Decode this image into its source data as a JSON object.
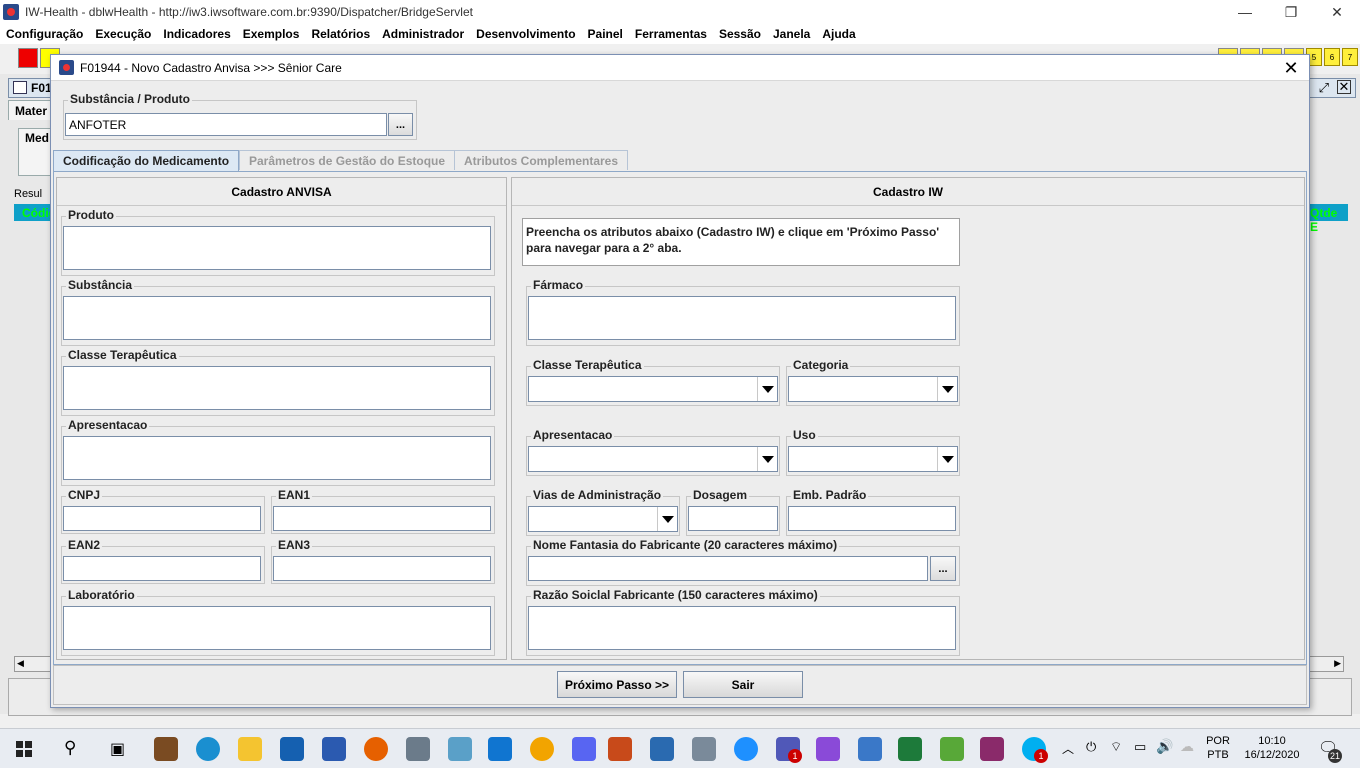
{
  "window": {
    "title": "IW-Health - dblwHealth - http://iw3.iwsoftware.com.br:9390/Dispatcher/BridgeServlet",
    "minimize": "—",
    "restore": "❐",
    "close": "✕"
  },
  "menu": [
    "Configuração",
    "Execução",
    "Indicadores",
    "Exemplos",
    "Relatórios",
    "Administrador",
    "Desenvolvimento",
    "Painel",
    "Ferramentas",
    "Sessão",
    "Janela",
    "Ajuda"
  ],
  "toolbar": {
    "number_boxes": [
      "5",
      "6",
      "7"
    ]
  },
  "background": {
    "frame_title": "F01",
    "tab_label": "Mater",
    "group_label": "Med",
    "result_label": "Resul",
    "col_left": "Códig",
    "col_right": "Qtde E"
  },
  "dialog": {
    "title": "F01944 - Novo Cadastro Anvisa >>> Sênior Care",
    "close": "✕",
    "substance": {
      "label": "Substância / Produto",
      "value": "ANFOTER",
      "lookup": "..."
    },
    "tabs": [
      "Codificação do Medicamento",
      "Parâmetros de Gestão do Estoque",
      "Atributos Complementares"
    ],
    "anvisa": {
      "header": "Cadastro ANVISA",
      "produto": "Produto",
      "substancia": "Substância",
      "classe": "Classe Terapêutica",
      "apresentacao": "Apresentacao",
      "cnpj": "CNPJ",
      "ean1": "EAN1",
      "ean2": "EAN2",
      "ean3": "EAN3",
      "laboratorio": "Laboratório"
    },
    "iw": {
      "header": "Cadastro IW",
      "info": "Preencha os atributos abaixo (Cadastro IW) e clique em 'Próximo Passo' para navegar para a 2° aba.",
      "farmaco": "Fármaco",
      "classe": "Classe Terapêutica",
      "categoria": "Categoria",
      "apresentacao": "Apresentacao",
      "uso": "Uso",
      "vias": "Vias de Administração",
      "dosagem": "Dosagem",
      "emb": "Emb. Padrão",
      "nome_fantasia": "Nome Fantasia do Fabricante (20 caracteres máximo)",
      "nome_lookup": "...",
      "razao": "Razão Soiclal Fabricante (150 caracteres máximo)"
    },
    "buttons": {
      "next": "Próximo Passo >>",
      "exit": "Sair"
    }
  },
  "taskbar": {
    "lang_top": "POR",
    "lang_bottom": "PTB",
    "time": "10:10",
    "date": "16/12/2020",
    "notifications": "21",
    "teams_badge": "1",
    "skype_badge": "1"
  }
}
